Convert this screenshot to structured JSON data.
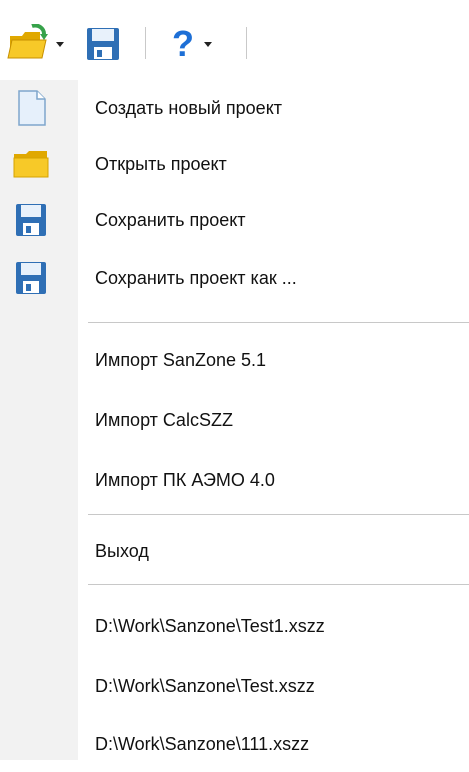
{
  "toolbar": {
    "open_icon": "folder-open-icon",
    "save_icon": "floppy-disk-icon",
    "help_label": "?"
  },
  "menu": {
    "new_project": "Создать новый проект",
    "open_project": "Открыть проект",
    "save_project": "Сохранить проект",
    "save_project_as": "Сохранить проект как ...",
    "import_sanzone": "Импорт SanZone 5.1",
    "import_calcszz": "Импорт CalcSZZ",
    "import_aemo": "Импорт ПК АЭМО 4.0",
    "exit": "Выход",
    "recent": [
      "D:\\Work\\Sanzone\\Test1.xszz",
      "D:\\Work\\Sanzone\\Test.xszz",
      "D:\\Work\\Sanzone\\111.xszz"
    ]
  },
  "colors": {
    "folder": "#f5c518",
    "floppy": "#2f6fb5",
    "help": "#1d6fd6"
  }
}
